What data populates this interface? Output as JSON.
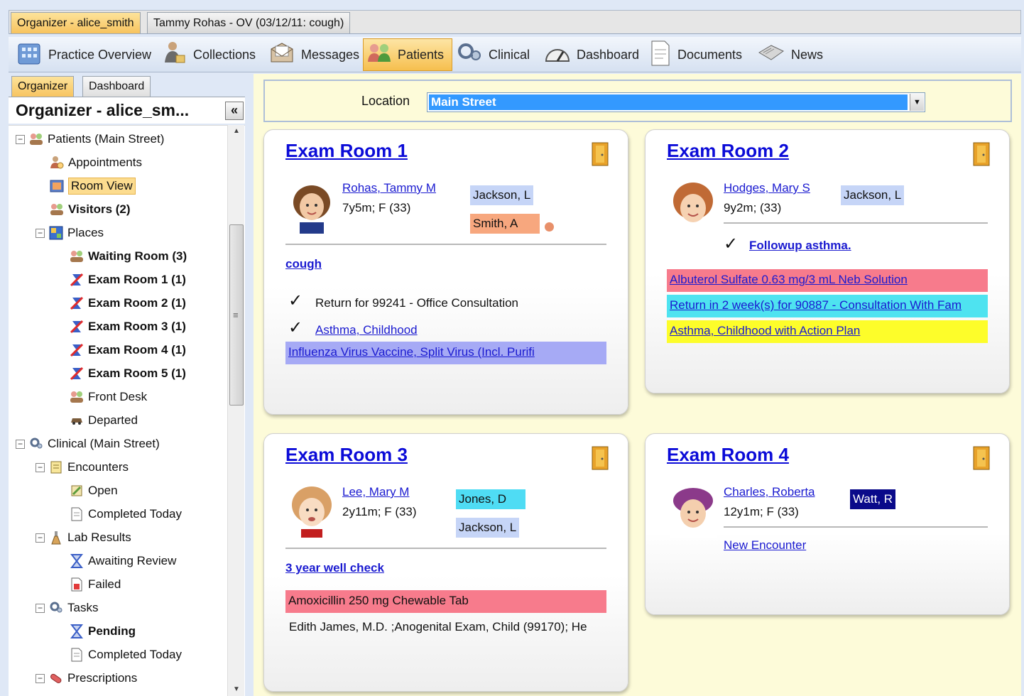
{
  "window_tabs": [
    "Organizer - alice_smith",
    "Tammy Rohas - OV (03/12/11: cough)"
  ],
  "toolbar": [
    {
      "label": "Practice Overview",
      "icon": "building-icon"
    },
    {
      "label": "Collections",
      "icon": "person-money-icon"
    },
    {
      "label": "Messages",
      "icon": "envelope-icon"
    },
    {
      "label": "Patients",
      "icon": "people-icon",
      "active": true
    },
    {
      "label": "Clinical",
      "icon": "stethoscope-icon"
    },
    {
      "label": "Dashboard",
      "icon": "gauge-icon"
    },
    {
      "label": "Documents",
      "icon": "document-icon"
    },
    {
      "label": "News",
      "icon": "newspaper-icon"
    }
  ],
  "left_tabs": [
    "Organizer",
    "Dashboard"
  ],
  "left_title": "Organizer  -  alice_sm...",
  "collapse_label": "«",
  "tree": {
    "patients": "Patients  (Main Street)",
    "appointments": "Appointments",
    "room_view": "Room View",
    "visitors": "Visitors  (2)",
    "places": "Places",
    "waiting_room": "Waiting Room  (3)",
    "exam_room_1": "Exam Room 1  (1)",
    "exam_room_2": "Exam Room 2  (1)",
    "exam_room_3": "Exam Room 3  (1)",
    "exam_room_4": "Exam Room 4  (1)",
    "exam_room_5": "Exam Room 5  (1)",
    "front_desk": "Front Desk",
    "departed": "Departed",
    "clinical": "Clinical  (Main Street)",
    "encounters": "Encounters",
    "open": "Open",
    "completed_today": "Completed Today",
    "lab_results": "Lab Results",
    "awaiting_review": "Awaiting Review",
    "failed": "Failed",
    "tasks": "Tasks",
    "pending": "Pending",
    "completed_today_2": "Completed Today",
    "prescriptions": "Prescriptions"
  },
  "location": {
    "label": "Location",
    "value": "Main Street"
  },
  "rooms": {
    "r1": {
      "title": "Exam Room 1",
      "patient": "Rohas, Tammy M",
      "info": "7y5m; F (33)",
      "providers": [
        "Jackson, L",
        "Smith, A"
      ],
      "reason": "cough",
      "items": [
        "Return for 99241 - Office Consultation",
        "Asthma, Childhood"
      ],
      "band": "Influenza Virus Vaccine, Split Virus (Incl. Purifi"
    },
    "r2": {
      "title": "Exam Room 2",
      "patient": "Hodges, Mary S",
      "info": "9y2m; (33)",
      "providers": [
        "Jackson, L"
      ],
      "reason": "Followup asthma.",
      "bands": [
        "Albuterol Sulfate 0.63 mg/3 mL Neb Solution",
        "Return in 2 week(s) for 90887 - Consultation With Fam",
        "Asthma, Childhood with Action Plan"
      ]
    },
    "r3": {
      "title": "Exam Room 3",
      "patient": "Lee, Mary M",
      "info": "2y11m; F (33)",
      "providers": [
        "Jones, D",
        "Jackson, L"
      ],
      "reason": "3 year well check",
      "band": "Amoxicillin 250 mg Chewable Tab",
      "note": "Edith James, M.D. ;Anogenital Exam, Child (99170); He"
    },
    "r4": {
      "title": "Exam Room 4",
      "patient": "Charles, Roberta",
      "info": "12y1m; F (33)",
      "providers": [
        "Watt, R"
      ],
      "link": "New Encounter"
    }
  },
  "colors": {
    "accent_orange": "#f7c35f",
    "link_blue": "#1a1ad0",
    "band_blue": "#a6aaf5",
    "band_red": "#f77b8c",
    "band_cyan": "#4ee3f0",
    "band_yellow": "#fdfd2a",
    "prov_blue": "#c6d5f7",
    "prov_orange": "#f7a77e",
    "prov_cyan": "#4fdcf4",
    "prov_navy": "#0a0a8a"
  }
}
